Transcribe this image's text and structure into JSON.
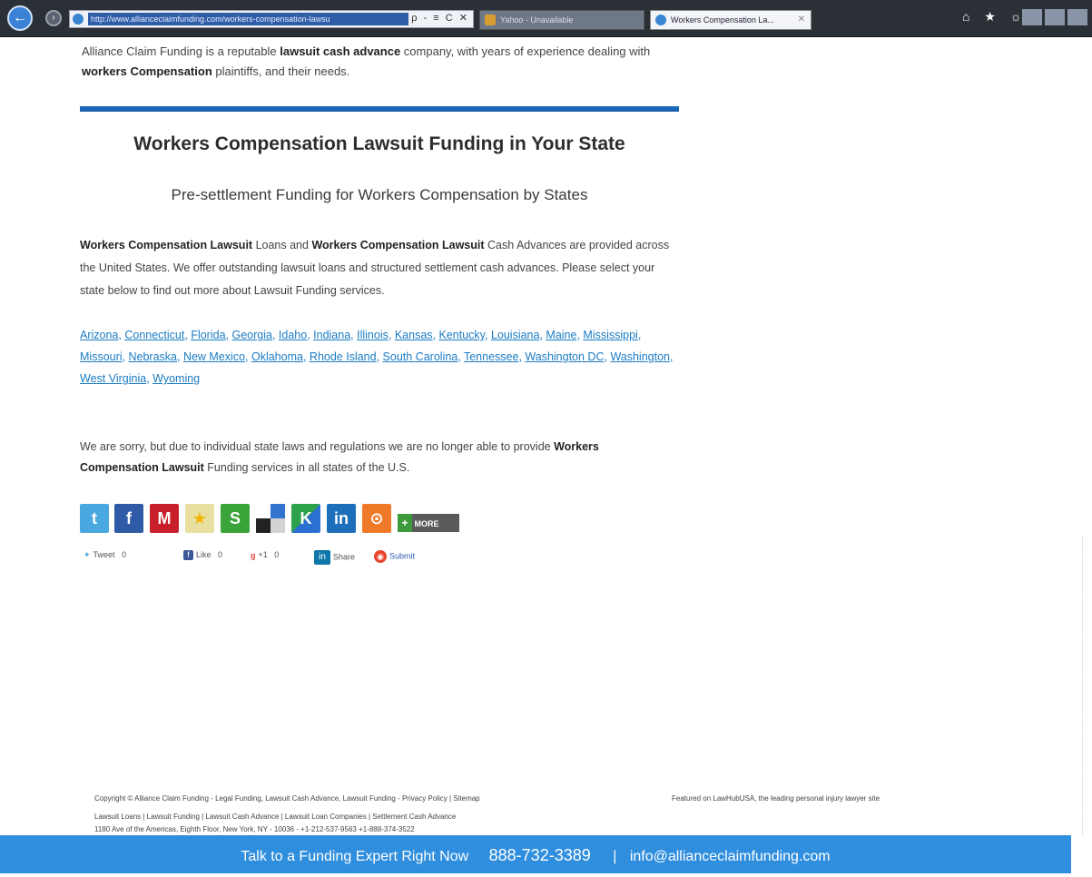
{
  "browser": {
    "url": "http://www.allianceclaimfunding.com/workers-compensation-lawsu",
    "addr_controls": "ρ - ≡ C ✕",
    "tabs": [
      {
        "label": "Yahoo - Unavailable"
      },
      {
        "label": "Workers Compensation La..."
      }
    ],
    "tab_close": "✕",
    "right_icons": "⌂ ★ ☼"
  },
  "page": {
    "intro": {
      "t1": "Alliance Claim Funding is a reputable ",
      "b1": "lawsuit cash advance",
      "t2": " company, with years of experience dealing with ",
      "b2": "workers Compensation",
      "t3": " plaintiffs, and their needs."
    },
    "heading": "Workers Compensation Lawsuit Funding in Your State",
    "subheading": "Pre-settlement Funding for Workers Compensation by States",
    "para": {
      "b1": "Workers Compensation Lawsuit",
      "t1": " Loans and ",
      "b2": "Workers Compensation Lawsuit",
      "t2": " Cash Advances are provided across the United States. We offer outstanding lawsuit loans and structured settlement cash advances. Please select your state below to find out more about Lawsuit Funding services."
    },
    "states": [
      "Arizona",
      "Connecticut",
      "Florida",
      "Georgia",
      "Idaho",
      "Indiana",
      "Illinois",
      "Kansas",
      "Kentucky",
      "Louisiana",
      "Maine",
      "Mississippi",
      "Missouri",
      "Nebraska",
      "New Mexico",
      "Oklahoma",
      "Rhode Island",
      "South Carolina",
      "Tennessee",
      "Washington DC",
      "Washington",
      "West Virginia",
      "Wyoming"
    ],
    "sorry": {
      "t1": "We are sorry, but due to individual state laws and regulations we are no longer able to provide ",
      "b1": "Workers Compensation Lawsuit",
      "t2": " Funding services in all states of the U.S."
    },
    "social": {
      "more_label": "MORE",
      "more_plus": "+",
      "tweet": "Tweet",
      "tweet_count": "0",
      "like": "Like",
      "like_count": "0",
      "gplus": "+1",
      "gplus_count": "0",
      "share": "Share",
      "submit": "Submit"
    },
    "footer": {
      "line1": "Copyright © Alliance Claim Funding - Legal Funding, Lawsuit Cash Advance, Lawsuit Funding - Privacy Policy | Sitemap",
      "right": "Featured on LawHubUSA, the leading personal injury lawyer site",
      "line2": "Lawsuit Loans | Lawsuit Funding | Lawsuit Cash Advance | Lawsuit Loan Companies | Settlement Cash Advance",
      "line3": "1180 Ave of the Americas, Eighth Floor, New York, NY - 10036 - +1-212-537-9563 +1-888-374-3522"
    },
    "bar": {
      "text": "Talk to a Funding Expert Right Now",
      "phone": "888-732-3389",
      "divider": "|",
      "email": "info@allianceclaimfunding.com"
    }
  },
  "colors": {
    "link": "#1b7cc4",
    "bar": "#2f8ede",
    "divider": "#1f6fc4"
  }
}
